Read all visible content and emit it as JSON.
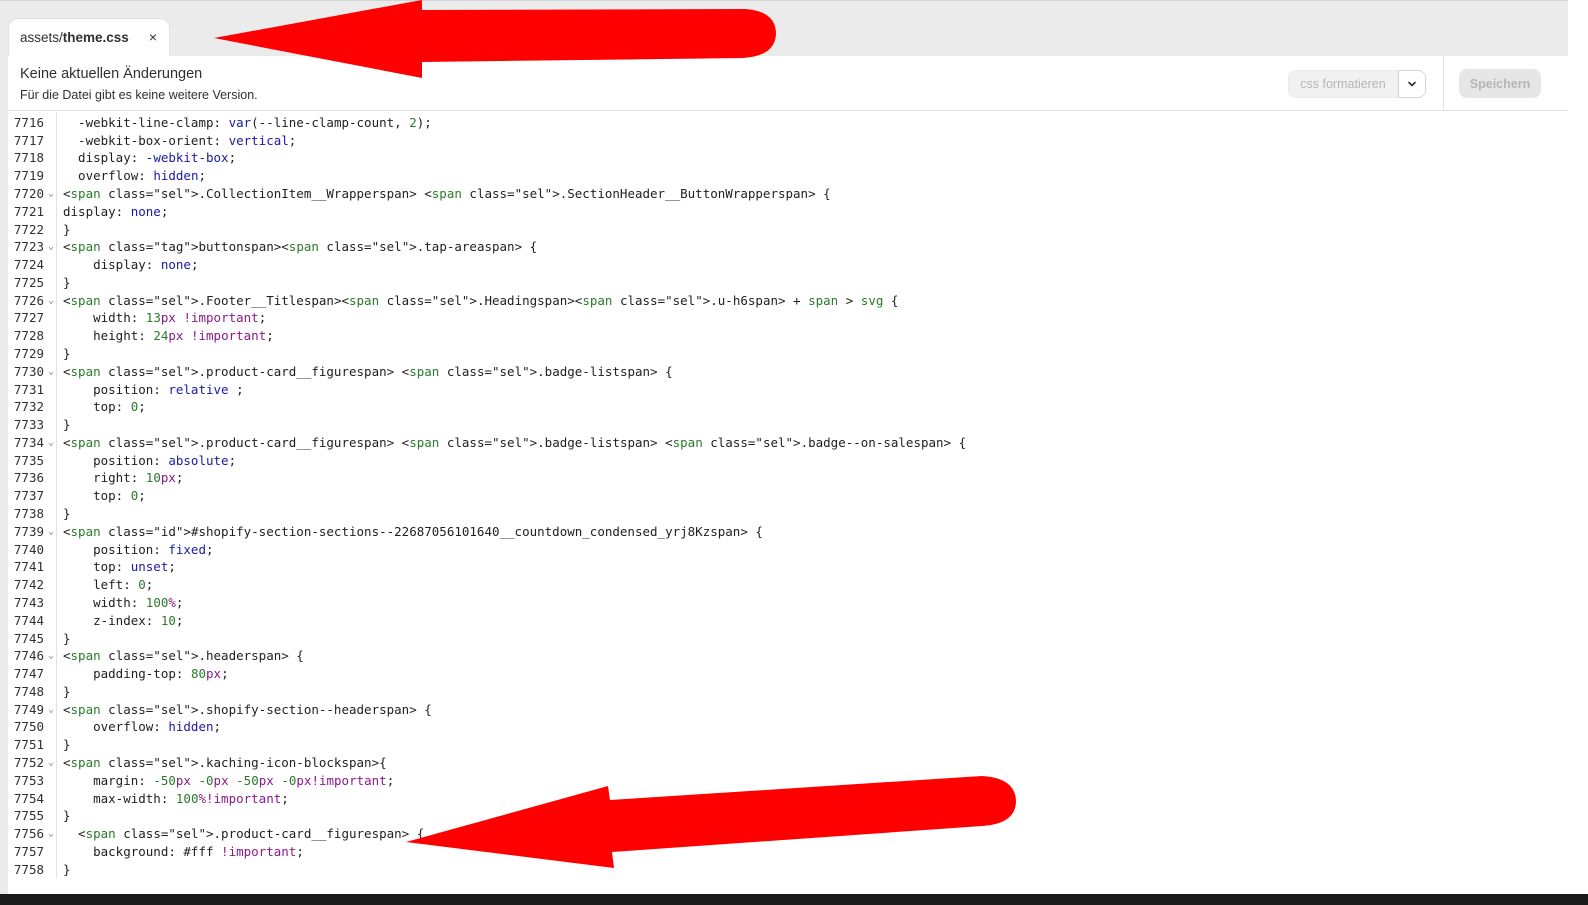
{
  "tab": {
    "path_prefix": "assets/",
    "file_name": "theme.css",
    "close_glyph": "×"
  },
  "status": {
    "title": "Keine aktuellen Änderungen",
    "subtitle": "Für die Datei gibt es keine weitere Version."
  },
  "toolbar": {
    "format_label": "css formatieren",
    "dropdown_icon": "chevron-down-icon",
    "save_label": "Speichern"
  },
  "colors": {
    "annotation_arrow": "#ff0000",
    "selector": "#1e5f74",
    "keyword": "#1a1aa6",
    "number": "#2a7a2a"
  },
  "code_lines": [
    {
      "n": "7716",
      "fold": false,
      "text": "  -webkit-line-clamp: var(--line-clamp-count, 2);"
    },
    {
      "n": "7717",
      "fold": false,
      "text": "  -webkit-box-orient: vertical;"
    },
    {
      "n": "7718",
      "fold": false,
      "text": "  display: -webkit-box;"
    },
    {
      "n": "7719",
      "fold": false,
      "text": "  overflow: hidden;"
    },
    {
      "n": "7720",
      "fold": true,
      "text": ".CollectionItem__Wrapper .SectionHeader__ButtonWrapper {"
    },
    {
      "n": "7721",
      "fold": false,
      "text": "display: none;"
    },
    {
      "n": "7722",
      "fold": false,
      "text": "}"
    },
    {
      "n": "7723",
      "fold": true,
      "text": "button.tap-area {"
    },
    {
      "n": "7724",
      "fold": false,
      "text": "    display: none;"
    },
    {
      "n": "7725",
      "fold": false,
      "text": "}"
    },
    {
      "n": "7726",
      "fold": true,
      "text": ".Footer__Title.Heading.u-h6 + span > svg {"
    },
    {
      "n": "7727",
      "fold": false,
      "text": "    width: 13px !important;"
    },
    {
      "n": "7728",
      "fold": false,
      "text": "    height: 24px !important;"
    },
    {
      "n": "7729",
      "fold": false,
      "text": "}"
    },
    {
      "n": "7730",
      "fold": true,
      "text": ".product-card__figure .badge-list {"
    },
    {
      "n": "7731",
      "fold": false,
      "text": "    position: relative ;"
    },
    {
      "n": "7732",
      "fold": false,
      "text": "    top: 0;"
    },
    {
      "n": "7733",
      "fold": false,
      "text": "}"
    },
    {
      "n": "7734",
      "fold": true,
      "text": ".product-card__figure .badge-list .badge--on-sale {"
    },
    {
      "n": "7735",
      "fold": false,
      "text": "    position: absolute;"
    },
    {
      "n": "7736",
      "fold": false,
      "text": "    right: 10px;"
    },
    {
      "n": "7737",
      "fold": false,
      "text": "    top: 0;"
    },
    {
      "n": "7738",
      "fold": false,
      "text": "}"
    },
    {
      "n": "7739",
      "fold": true,
      "text": "#shopify-section-sections--22687056101640__countdown_condensed_yrj8Kz {"
    },
    {
      "n": "7740",
      "fold": false,
      "text": "    position: fixed;"
    },
    {
      "n": "7741",
      "fold": false,
      "text": "    top: unset;"
    },
    {
      "n": "7742",
      "fold": false,
      "text": "    left: 0;"
    },
    {
      "n": "7743",
      "fold": false,
      "text": "    width: 100%;"
    },
    {
      "n": "7744",
      "fold": false,
      "text": "    z-index: 10;"
    },
    {
      "n": "7745",
      "fold": false,
      "text": "}"
    },
    {
      "n": "7746",
      "fold": true,
      "text": ".header {"
    },
    {
      "n": "7747",
      "fold": false,
      "text": "    padding-top: 80px;"
    },
    {
      "n": "7748",
      "fold": false,
      "text": "}"
    },
    {
      "n": "7749",
      "fold": true,
      "text": ".shopify-section--header {"
    },
    {
      "n": "7750",
      "fold": false,
      "text": "    overflow: hidden;"
    },
    {
      "n": "7751",
      "fold": false,
      "text": "}"
    },
    {
      "n": "7752",
      "fold": true,
      "text": ".kaching-icon-block{"
    },
    {
      "n": "7753",
      "fold": false,
      "text": "    margin: -50px -0px -50px -0px!important;"
    },
    {
      "n": "7754",
      "fold": false,
      "text": "    max-width: 100%!important;"
    },
    {
      "n": "7755",
      "fold": false,
      "text": "}"
    },
    {
      "n": "7756",
      "fold": true,
      "text": "  .product-card__figure {"
    },
    {
      "n": "7757",
      "fold": false,
      "text": "    background: #fff !important;"
    },
    {
      "n": "7758",
      "fold": false,
      "text": "}"
    }
  ]
}
